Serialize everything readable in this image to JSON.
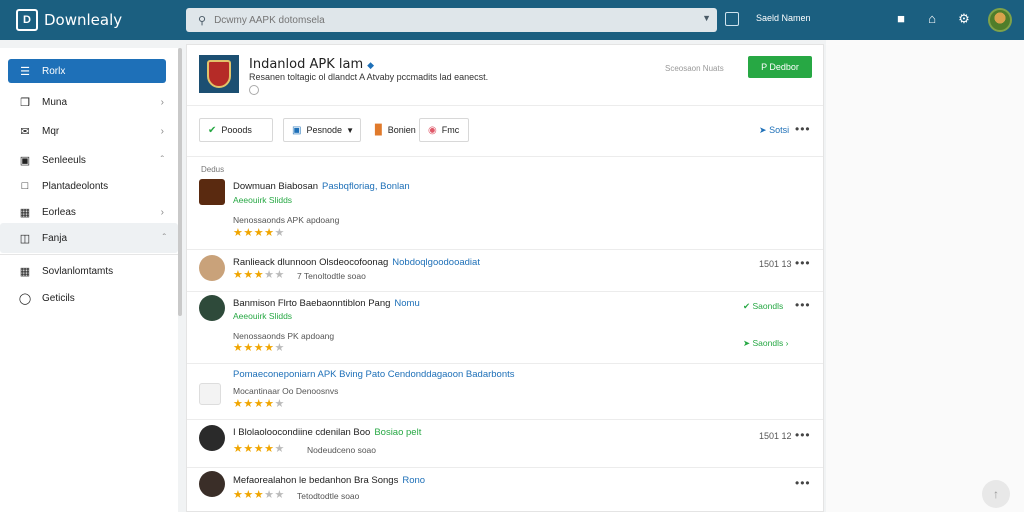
{
  "header": {
    "logo_text": "Downlealy",
    "search_placeholder": "Dcwmy AAPK dotomsela",
    "account_label": "Saeld Namen"
  },
  "sidebar": {
    "items": [
      {
        "label": "Rorlx",
        "icon": "menu-icon"
      },
      {
        "label": "Muna",
        "icon": "book-icon"
      },
      {
        "label": "Mqr",
        "icon": "mail-icon"
      },
      {
        "label": "Senleeuls",
        "icon": "list-icon"
      },
      {
        "label": "Plantadeolonts",
        "icon": "doc-icon"
      },
      {
        "label": "Eorleas",
        "icon": "folder-icon"
      },
      {
        "label": "Fanja",
        "icon": "calendar-icon"
      },
      {
        "label": "Sovlanlomtamts",
        "icon": "grid-icon"
      },
      {
        "label": "Geticils",
        "icon": "settings-icon"
      }
    ]
  },
  "app": {
    "title": "Indanlod APK lam",
    "description": "Resanen toltagic ol dlandct A Atvaby pccmadits lad eanecst.",
    "download_count": "Sceosaon Nuats",
    "download_label": "P Dedbor"
  },
  "toolbar": {
    "btn1": "Pooods",
    "btn2": "Pesnode",
    "btn3": "Bonien",
    "btn4": "Fmc",
    "share": "Sotsi"
  },
  "section_label": "Dedus",
  "reviews": [
    {
      "title": "Dowmuan Biabosan",
      "tag": "Pasbqfloriag, Bonlan",
      "sub": "Aeeouirk Slidds",
      "meta": "Nenossaonds APK apdoang",
      "rating": 4,
      "date": "",
      "action": ""
    },
    {
      "title": "Ranlieack dlunnoon Olsdeocofoonag",
      "tag": "Nobdoqlgoodooadiat",
      "sub": "",
      "meta": "7 Tenoltodtle soao",
      "rating": 3,
      "date": "1501 13",
      "action": ""
    },
    {
      "title": "Banmison Flrto Baebaonntiblon Pang",
      "tag": "Nomu",
      "sub": "Aeeouirk Slidds",
      "meta": "Nenossaonds PK apdoang",
      "rating": 4,
      "date": "",
      "action": "Saondls"
    },
    {
      "title": "Pomaeconeponiarn APK Bving Pato Cendonddagaoon Badarbonts",
      "tag": "",
      "sub": "",
      "meta": "Mocantinaar Oo Denoosnvs",
      "rating": 4,
      "date": "",
      "action": ""
    },
    {
      "title": "I Blolaoloocondiine cdenilan Boo",
      "tag": "Bosiao pelt",
      "sub": "",
      "meta": "Nodeudceno soao",
      "rating": 4,
      "date": "1501 12",
      "action": ""
    },
    {
      "title": "Mefaorealahon le bedanhon Bra Songs",
      "tag": "Rono",
      "sub": "",
      "meta": "Tetodtodtle soao",
      "rating": 3,
      "date": "",
      "action": ""
    }
  ]
}
